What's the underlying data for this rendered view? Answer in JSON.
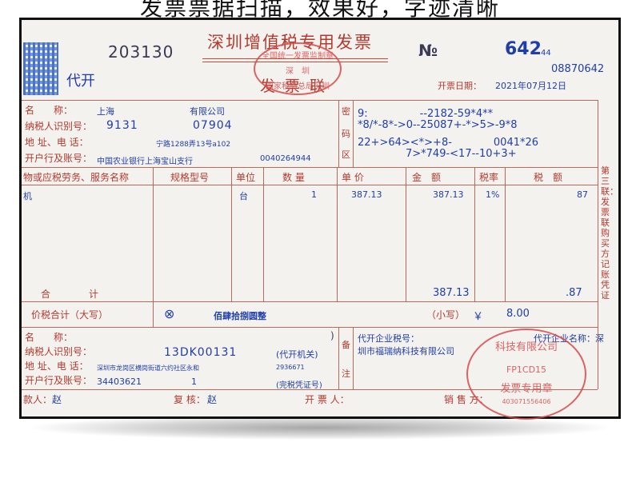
{
  "banner": "发票票据扫描，效果好，字迹清晰",
  "header": {
    "code": "203130",
    "title": "深圳增值税专用发票",
    "subtitle": "发 票 联",
    "issued_by_agent": "代开",
    "no_symbol": "№",
    "no_big": "642",
    "no_small": "44",
    "no_second": "08870642",
    "date_label": "开票日期：",
    "date_value": "2021年07月12日"
  },
  "buyer": {
    "name_label": "名　　称：",
    "name_value_a": "上海",
    "name_value_b": "有限公司",
    "tax_label": "纳税人识别号：",
    "tax_value_a": "9131",
    "tax_value_b": "07904",
    "addr_label": "地 址、电 话：",
    "addr_value": "宁路1288弄13号a102",
    "bank_label": "开户行及账号：",
    "bank_value": "中国农业银行上海宝山支行",
    "bank_account": "0040264944"
  },
  "cipher": {
    "side": [
      "密",
      "码",
      "区"
    ],
    "lines": [
      "9:　　　　　--2182-59*4**",
      "*8/*-8*->0--25087+-*>5>-9*8",
      "22+>64><*>+8-　　　　0041*26",
      "7>*749-<17--10+3+"
    ]
  },
  "items": {
    "headers": [
      "物或应税劳务、服务名称",
      "规格型号",
      "单位",
      "数 量",
      "单 价",
      "金　额",
      "税率",
      "税　额"
    ],
    "row": {
      "name": "机",
      "unit": "台",
      "qty": "1",
      "price": "387.13",
      "amount": "387.13",
      "rate": "1%",
      "tax": "87"
    },
    "total_label": "合　　　　计",
    "total_amount": "387.13",
    "total_tax": ".87"
  },
  "tax_total": {
    "label": "价税合计（大写）",
    "symbol": "⊗",
    "upper": "佰肆拾捌圆整",
    "lower_label": "（小写）",
    "currency": "￥",
    "lower_value": "8.00"
  },
  "seller": {
    "name_label": "名　　称：",
    "name_end": ")",
    "tax_label": "纳税人识别号：",
    "tax_value": "13DK00131",
    "tax_note": "(代开机关)",
    "addr_label": "地 址、电 话：",
    "addr_value": "深圳市龙岗区横岗街道六约社区永和",
    "addr_phone": "2936671",
    "bank_label": "开户行及账号：",
    "bank_value_a": "34403621",
    "bank_value_b": "1",
    "bank_note": "(完税凭证号)"
  },
  "remarks": {
    "side": [
      "备",
      "注"
    ],
    "line1_label": "代开企业税号：",
    "line1_right": "代开企业名称：深",
    "line2": "圳市福瑞纳科技有限公司"
  },
  "footer": {
    "payee": "款人：",
    "payee_name": "赵",
    "review": "复 核：",
    "review_name": "赵",
    "drawer": "开 票 人：",
    "seller": "销 售 方："
  },
  "side_label": "第三联：发票联　购买方记账凭证",
  "stamps": {
    "center_top": "全国统一发票监制章",
    "center_mid": "深　圳",
    "center_bot": "国家税务总局深圳",
    "seal_text": "科技有限公司",
    "seal_code": "FP1CD15",
    "seal_bottom": "发票专用章",
    "seal_number": "403071556406"
  }
}
